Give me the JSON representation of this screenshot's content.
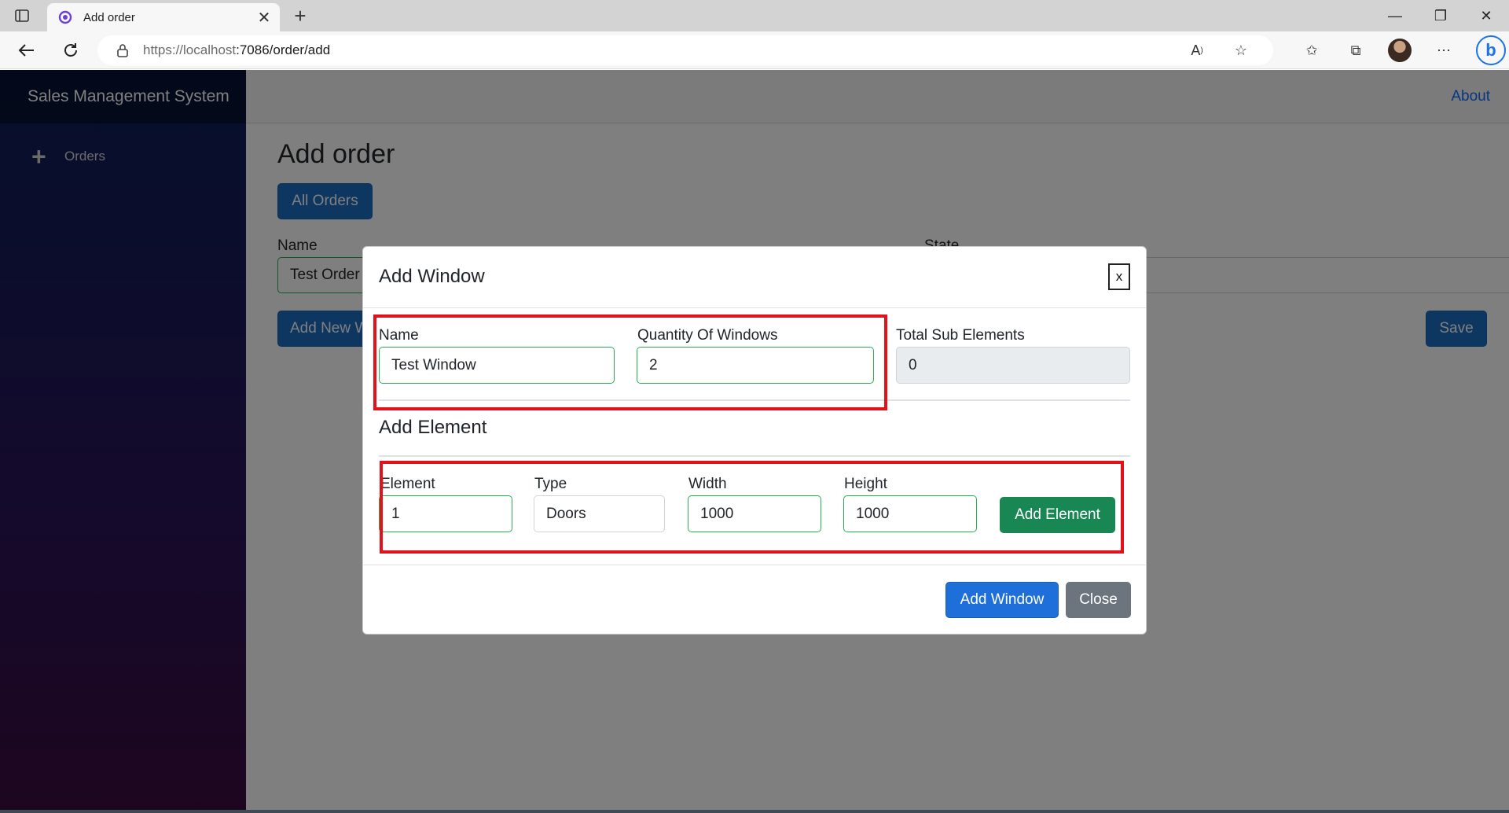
{
  "browser": {
    "tab_title": "Add order",
    "tab_close": "✕",
    "new_tab": "+",
    "url_host": "https://localhost",
    "url_rest": ":7086/order/add",
    "minimize": "—",
    "restore": "❐",
    "close": "✕"
  },
  "app": {
    "brand": "Sales Management System",
    "nav_about": "About",
    "sidebar_items": [
      {
        "label": "Orders",
        "icon": "plus-icon"
      }
    ]
  },
  "page": {
    "title": "Add order",
    "all_orders_label": "All Orders",
    "name_label": "Name",
    "name_value": "Test Order",
    "state_label": "State",
    "add_new_label": "Add New Window",
    "save_label": "Save"
  },
  "modal": {
    "title": "Add Window",
    "close_label": "x",
    "name_label": "Name",
    "name_value": "Test Window",
    "quantity_label": "Quantity Of Windows",
    "quantity_value": "2",
    "total_label": "Total Sub Elements",
    "total_value": "0",
    "add_element_title": "Add Element",
    "element_label": "Element",
    "element_value": "1",
    "type_label": "Type",
    "type_value": "Doors",
    "width_label": "Width",
    "width_value": "1000",
    "height_label": "Height",
    "height_value": "1000",
    "add_element_button": "Add Element",
    "add_window_button": "Add Window",
    "close_button": "Close"
  },
  "colors": {
    "primary": "#1b6ec2",
    "success": "#198754",
    "secondary": "#6c757d",
    "highlight": "#e2111a"
  }
}
